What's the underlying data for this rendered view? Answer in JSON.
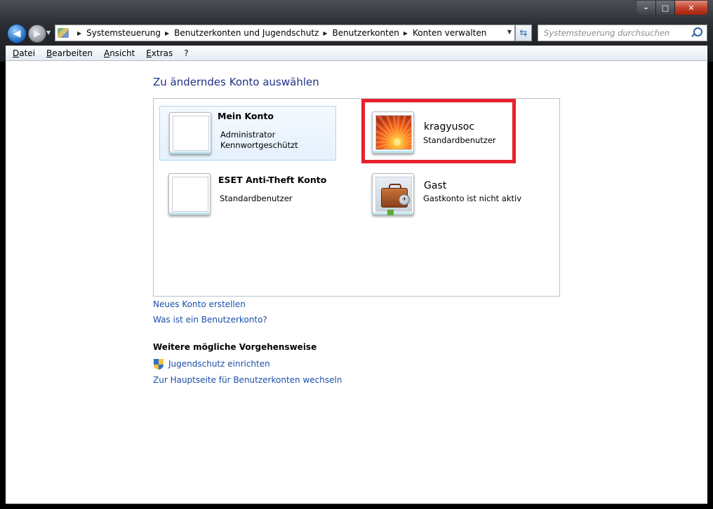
{
  "window": {
    "controls": {
      "minimize": "–",
      "maximize": "□",
      "close": "✕"
    }
  },
  "nav": {
    "back_glyph": "◀",
    "forward_glyph": "▶",
    "breadcrumb": [
      "Systemsteuerung",
      "Benutzerkonten und Jugendschutz",
      "Benutzerkonten",
      "Konten verwalten"
    ],
    "refresh_glyph": "⇆",
    "search_placeholder": "Systemsteuerung durchsuchen"
  },
  "menu": [
    "Datei",
    "Bearbeiten",
    "Ansicht",
    "Extras",
    "?"
  ],
  "page": {
    "title": "Zu änderndes Konto auswählen",
    "accounts": [
      {
        "name": "Mein Konto",
        "lines": [
          "Administrator",
          "Kennwortgeschützt"
        ],
        "picture": "blank",
        "selected": true
      },
      {
        "name": "kragyusoc",
        "lines": [
          "Standardbenutzer"
        ],
        "picture": "orange-flower",
        "highlighted": true
      },
      {
        "name": "ESET Anti-Theft Konto",
        "lines": [
          "Standardbenutzer"
        ],
        "picture": "blank"
      },
      {
        "name": "Gast",
        "lines": [
          "Gastkonto ist nicht aktiv"
        ],
        "picture": "suitcase"
      }
    ],
    "links": {
      "new_account": "Neues Konto erstellen",
      "what_is": "Was ist ein Benutzerkonto?"
    },
    "more_options_title": "Weitere mögliche Vorgehensweise",
    "more_options": {
      "parental": "Jugendschutz einrichten",
      "main_page": "Zur Hauptseite für Benutzerkonten wechseln"
    }
  },
  "colors": {
    "link": "#1a4fa8",
    "title": "#1e3287",
    "highlight_box": "#e8202d"
  }
}
